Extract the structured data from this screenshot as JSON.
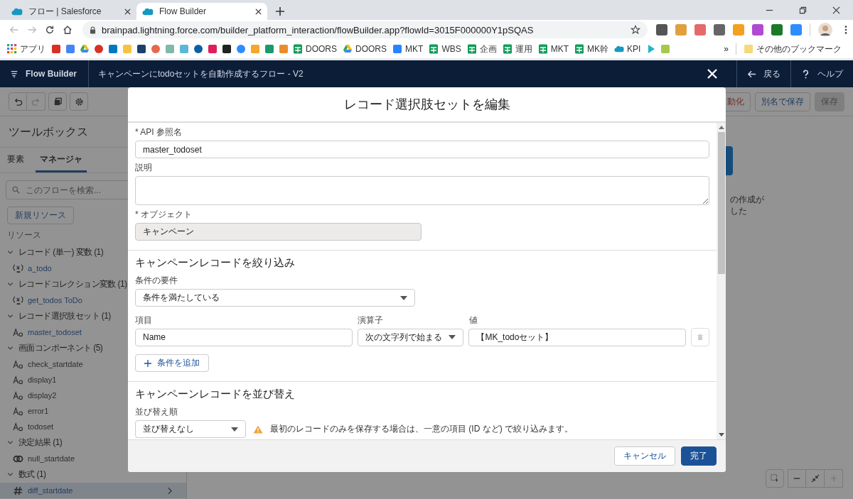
{
  "browser": {
    "tabs": [
      {
        "title": "フロー | Salesforce",
        "selected": false
      },
      {
        "title": "Flow Builder",
        "selected": true
      }
    ],
    "url": "brainpad.lightning.force.com/builder_platform_interaction/flowBuilder.app?flowId=3015F000000Y1pSQAS",
    "bookmarks": [
      {
        "kind": "apps",
        "label": "アプリ"
      },
      {
        "kind": "tile",
        "color": "#d93025"
      },
      {
        "kind": "tile",
        "color": "#4285f4"
      },
      {
        "kind": "drive"
      },
      {
        "kind": "circle",
        "color": "#d93025"
      },
      {
        "kind": "tile",
        "color": "#0079bf"
      },
      {
        "kind": "tile",
        "color": "#f5c342"
      },
      {
        "kind": "tile",
        "color": "#1d3f6e"
      },
      {
        "kind": "circle",
        "color": "#e8664a"
      },
      {
        "kind": "tile",
        "color": "#7fb9a9"
      },
      {
        "kind": "tile",
        "color": "#5bb8d6"
      },
      {
        "kind": "circle",
        "color": "#0b5fa5"
      },
      {
        "kind": "tile",
        "color": "#e01e5a"
      },
      {
        "kind": "tile",
        "color": "#222222"
      },
      {
        "kind": "circle",
        "color": "#2d8cff"
      },
      {
        "kind": "tile",
        "color": "#f4a72a"
      },
      {
        "kind": "tile",
        "color": "#1a9a6c"
      },
      {
        "kind": "tile",
        "color": "#e98d2b"
      },
      {
        "kind": "sheets",
        "label": "DOORS"
      },
      {
        "kind": "drive",
        "label": "DOORS"
      },
      {
        "kind": "tile",
        "color": "#2684ff",
        "label": "MKT"
      },
      {
        "kind": "sheets",
        "label": "WBS"
      },
      {
        "kind": "sheets",
        "label": "企画"
      },
      {
        "kind": "sheets",
        "label": "運用"
      },
      {
        "kind": "sheets",
        "label": "MKT"
      },
      {
        "kind": "sheets",
        "label": "MK幹"
      },
      {
        "kind": "cloud",
        "label": "KPI"
      },
      {
        "kind": "play",
        "color": "#1fb5c9"
      },
      {
        "kind": "tile",
        "color": "#a6c94a"
      }
    ],
    "more": "»",
    "other_bookmarks": "その他のブックマーク",
    "extensions": [
      {
        "color": "#555555"
      },
      {
        "color": "#e0a040"
      },
      {
        "color": "#e46a6a"
      },
      {
        "color": "#666666"
      },
      {
        "color": "#f4a020"
      },
      {
        "color": "#b04ad0"
      },
      {
        "color": "#1a7a2a"
      },
      {
        "color": "#2d8cff"
      }
    ]
  },
  "app": {
    "name": "Flow Builder",
    "flow_title": "キャンペーンにtodoセットを自動作成するフロー - V2",
    "back": "戻る",
    "help": "ヘルプ"
  },
  "toolbar": {
    "tools": [
      {
        "kind": "undo",
        "disabled": false
      },
      {
        "kind": "redo",
        "disabled": true
      },
      {
        "kind": "copy",
        "disabled": false
      },
      {
        "kind": "settings",
        "disabled": false
      }
    ],
    "actions": [
      {
        "label": "動化",
        "kind": "danger",
        "disabled": false
      },
      {
        "label": "別名で保存",
        "kind": "neutral",
        "disabled": false
      },
      {
        "label": "保存",
        "kind": "neutral",
        "disabled": true
      }
    ]
  },
  "toolbox": {
    "title": "ツールボックス",
    "tabs": [
      {
        "label": "要素",
        "selected": false
      },
      {
        "label": "マネージャ",
        "selected": true
      }
    ],
    "search": {
      "placeholder": "このフローを検索..."
    },
    "new_resource": "新規リソース",
    "resources_label": "リソース",
    "groups": [
      {
        "label": "レコード (単一) 変数 (1)",
        "expanded": true,
        "children": [
          {
            "label": "a_todo",
            "kind": "variable",
            "highlighted": true,
            "hovered": false
          }
        ]
      },
      {
        "label": "レコードコレクション変数 (1)",
        "expanded": true,
        "children": [
          {
            "label": "get_todos ToDo",
            "kind": "variable",
            "highlighted": true,
            "hovered": false
          }
        ]
      },
      {
        "label": "レコード選択肢セット (1)",
        "expanded": true,
        "children": [
          {
            "label": "master_todoset",
            "kind": "text",
            "highlighted": true,
            "hovered": false
          }
        ]
      },
      {
        "label": "画面コンポーネント (5)",
        "expanded": true,
        "children": [
          {
            "label": "check_startdate",
            "kind": "text",
            "highlighted": false,
            "hovered": false
          },
          {
            "label": "display1",
            "kind": "text",
            "highlighted": false,
            "hovered": false
          },
          {
            "label": "display2",
            "kind": "text",
            "highlighted": false,
            "hovered": false
          },
          {
            "label": "error1",
            "kind": "text",
            "highlighted": false,
            "hovered": false
          },
          {
            "label": "todoset",
            "kind": "text",
            "highlighted": false,
            "hovered": false
          }
        ]
      },
      {
        "label": "決定結果 (1)",
        "expanded": true,
        "children": [
          {
            "label": "null_startdate",
            "kind": "decision",
            "highlighted": false,
            "hovered": false
          }
        ]
      },
      {
        "label": "数式 (1)",
        "expanded": true,
        "children": [
          {
            "label": "diff_startdate",
            "kind": "formula",
            "highlighted": true,
            "hovered": true
          }
        ]
      }
    ]
  },
  "canvas": {
    "lines": [
      "の作成が",
      "した"
    ]
  },
  "modal": {
    "title": "レコード選択肢セットを編集",
    "api_name": {
      "label": "* API 参照名",
      "value": "master_todoset"
    },
    "description": {
      "label": "説明"
    },
    "object": {
      "label": "* オブジェクト",
      "value": "キャンペーン"
    },
    "filter": {
      "heading": "キャンペーンレコードを絞り込み",
      "requirement_label": "条件の要件",
      "requirement": "条件を満たしている",
      "columns": [
        "項目",
        "演算子",
        "値"
      ],
      "conditions": [
        {
          "field": "Name",
          "operator": "次の文字列で始まる",
          "value": "【MK_todoセット】"
        }
      ],
      "add_condition": "条件を追加"
    },
    "sort": {
      "heading": "キャンペーンレコードを並び替え",
      "order_label": "並び替え順",
      "order": "並び替えなし",
      "warning": "最初のレコードのみを保存する場合は、一意の項目 (ID など) で絞り込みます。"
    },
    "cancel": "キャンセル",
    "done": "完了"
  }
}
